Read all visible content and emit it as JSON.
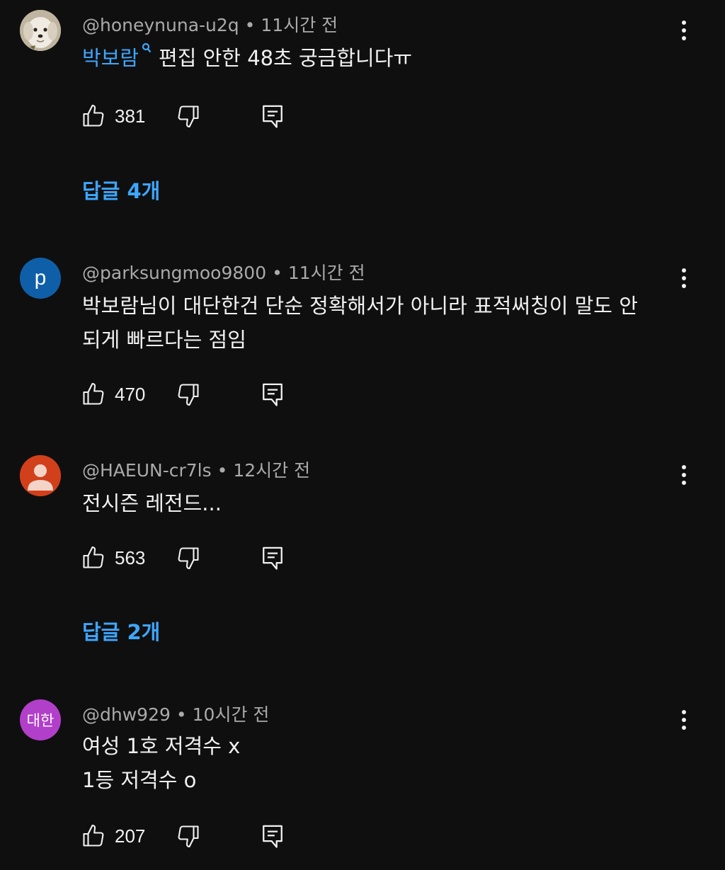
{
  "comments": [
    {
      "author": "@honeynuna-u2q",
      "time": "11시간 전",
      "mention": "박보람",
      "text": "편집 안한 48초 궁금합니다ㅠ",
      "likes": "381",
      "replies": "답글 4개"
    },
    {
      "author": "@parksungmoo9800",
      "time": "11시간 전",
      "avatar_letter": "p",
      "text_line1": "박보람님이 대단한건 단순 정확해서가 아니라 표적써칭이 말도 안",
      "text_line2": "되게 빠르다는 점임",
      "likes": "470"
    },
    {
      "author": "@HAEUN-cr7ls",
      "time": "12시간 전",
      "text": "전시즌 레전드...",
      "likes": "563",
      "replies": "답글 2개"
    },
    {
      "author": "@dhw929",
      "time": "10시간 전",
      "avatar_text": "대한",
      "text_line1": "여성 1호 저격수 x",
      "text_line2": "1등 저격수 o",
      "likes": "207"
    }
  ],
  "separator": "•",
  "colors": {
    "background": "#0f0f0f",
    "link": "#3ea6ff",
    "meta": "#aaaaaa"
  }
}
